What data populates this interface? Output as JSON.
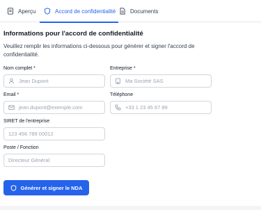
{
  "tabs": [
    {
      "label": "Aperçu",
      "icon": "document-icon"
    },
    {
      "label": "Accord de confidentialité",
      "icon": "shield-icon"
    },
    {
      "label": "Documents",
      "icon": "file-icon"
    }
  ],
  "form": {
    "title": "Informations pour l'accord de confidentialité",
    "description": "Veuillez remplir les informations ci-dessous pour générer et signer l'accord de confidentialité.",
    "fields": {
      "full_name": {
        "label": "Nom complet *",
        "placeholder": "Jean Dupont"
      },
      "company": {
        "label": "Entreprise *",
        "placeholder": "Ma Société SAS"
      },
      "email": {
        "label": "Email *",
        "placeholder": "jean.dupont@exemple.com"
      },
      "phone": {
        "label": "Téléphone",
        "placeholder": "+33 1 23 45 67 89"
      },
      "siret": {
        "label": "SIRET de l'entreprise",
        "placeholder": "123 456 789 00012"
      },
      "position": {
        "label": "Poste / Fonction",
        "placeholder": "Directeur Général"
      }
    },
    "submit_label": "Générer et signer le NDA"
  },
  "colors": {
    "accent": "#2563eb",
    "border": "#d1d5db",
    "placeholder": "#9ca3af"
  }
}
